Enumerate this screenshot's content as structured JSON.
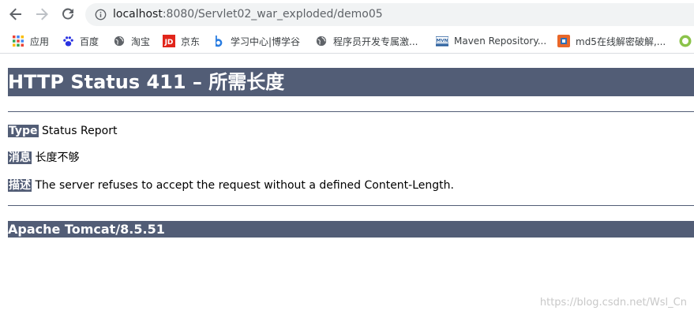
{
  "browser": {
    "url_host": "localhost",
    "url_rest": ":8080/Servlet02_war_exploded/demo05"
  },
  "bookmarks": [
    {
      "label": "应用",
      "icon": "apps-grid-icon"
    },
    {
      "label": "百度",
      "icon": "baidu-paw-icon"
    },
    {
      "label": "淘宝",
      "icon": "globe-icon"
    },
    {
      "label": "京东",
      "icon": "jd-logo-icon"
    },
    {
      "label": "学习中心|博学谷",
      "icon": "boxuegu-logo-icon"
    },
    {
      "label": "程序员开发专属激...",
      "icon": "globe-icon"
    },
    {
      "label": "Maven Repository...",
      "icon": "maven-logo-icon"
    },
    {
      "label": "md5在线解密破解,...",
      "icon": "md5-logo-icon"
    }
  ],
  "page": {
    "heading": "HTTP Status 411 – 所需长度",
    "type_label": "Type",
    "type_value": "Status Report",
    "message_label": "消息",
    "message_value": "长度不够",
    "description_label": "描述",
    "description_value": "The server refuses to accept the request without a defined Content-Length.",
    "server_info": "Apache Tomcat/8.5.51"
  },
  "watermark": "https://blog.csdn.net/Wsl_Cn",
  "colors": {
    "tomcat_header_bg": "#525d76",
    "omnibox_bg": "#f1f3f4"
  }
}
